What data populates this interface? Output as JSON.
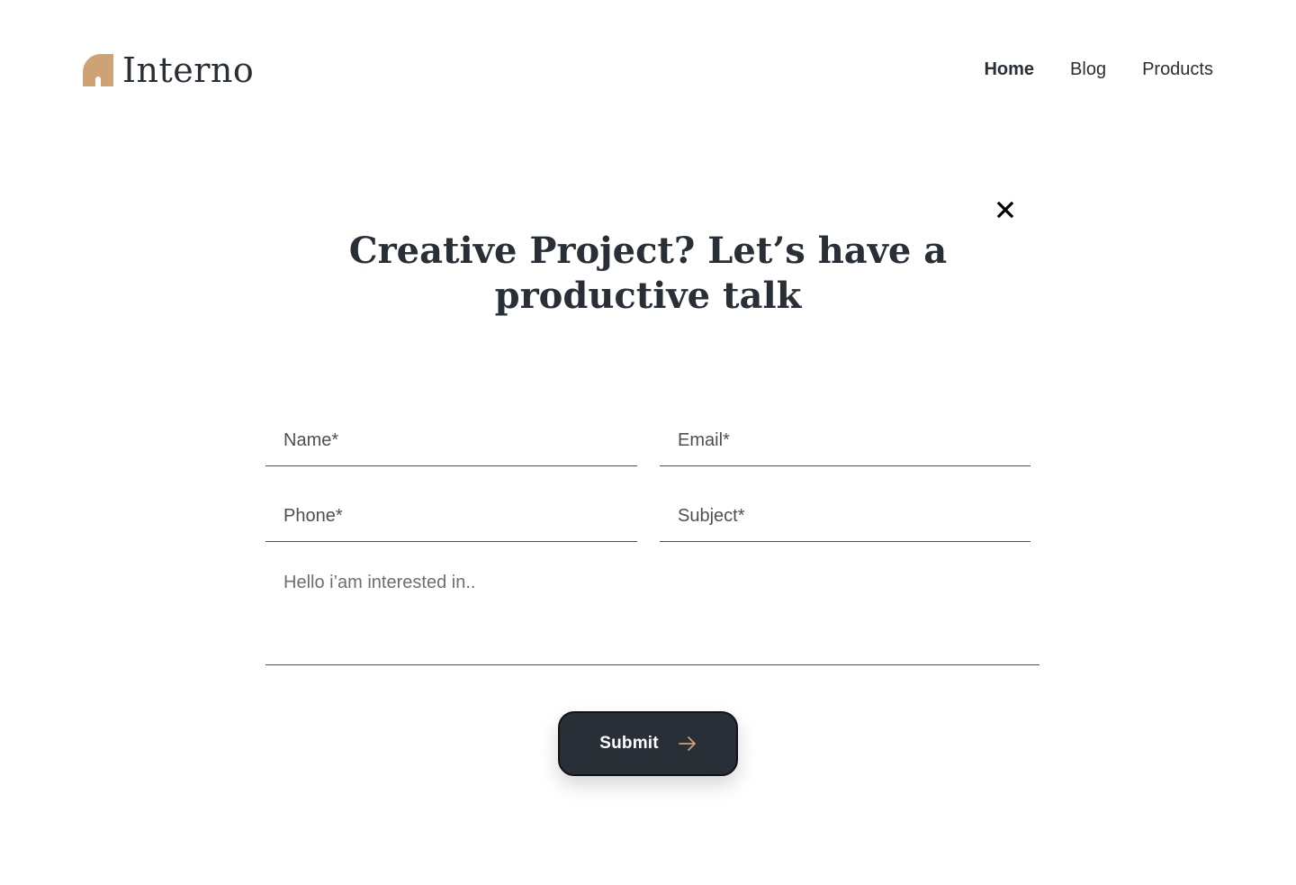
{
  "brand": {
    "name": "Interno",
    "logo_icon": "arch-logo-icon",
    "accent_color": "#cda274",
    "primary_color": "#292f36"
  },
  "nav": {
    "items": [
      {
        "label": "Home",
        "active": true
      },
      {
        "label": "Blog",
        "active": false
      },
      {
        "label": "Products",
        "active": false
      }
    ]
  },
  "modal": {
    "close_icon": "close-icon",
    "title_line1": "Creative Project? Let’s have a",
    "title_line2": "productive talk"
  },
  "form": {
    "name_placeholder": "Name*",
    "email_placeholder": "Email*",
    "phone_placeholder": "Phone*",
    "subject_placeholder": "Subject*",
    "message_placeholder": "Hello i’am interested in..",
    "submit_label": "Submit",
    "submit_icon": "arrow-right-icon"
  }
}
